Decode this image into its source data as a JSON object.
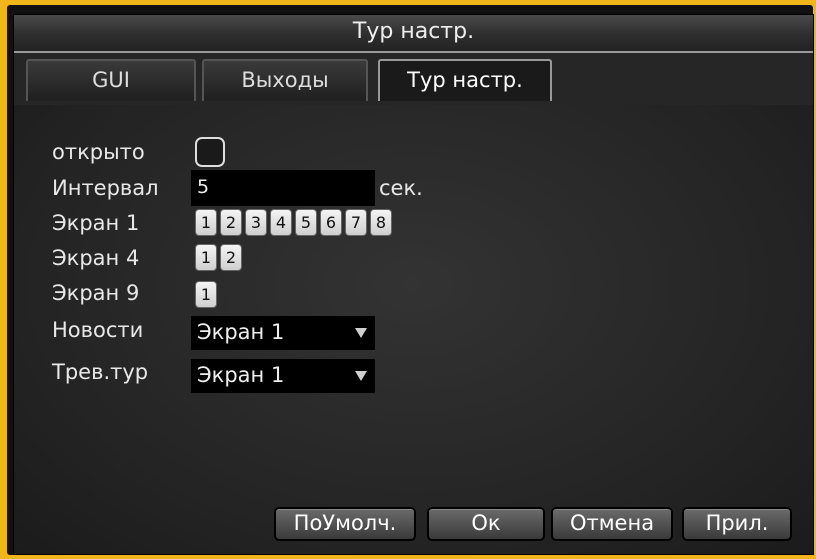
{
  "window": {
    "title": "Тур настр."
  },
  "tabs": [
    {
      "label": "GUI"
    },
    {
      "label": "Выходы"
    },
    {
      "label": "Тур настр.",
      "active": true
    }
  ],
  "form": {
    "open": {
      "label": "открыто",
      "checked": false
    },
    "interval": {
      "label": "Интервал",
      "value": "5",
      "unit": "сек."
    },
    "screen1": {
      "label": "Экран 1",
      "buttons": [
        "1",
        "2",
        "3",
        "4",
        "5",
        "6",
        "7",
        "8"
      ]
    },
    "screen4": {
      "label": "Экран 4",
      "buttons": [
        "1",
        "2"
      ]
    },
    "screen9": {
      "label": "Экран 9",
      "buttons": [
        "1"
      ]
    },
    "news": {
      "label": "Новости",
      "value": "Экран 1"
    },
    "alarm_tour": {
      "label": "Трев.тур",
      "value": "Экран 1"
    }
  },
  "buttons": {
    "default": "ПоУмолч.",
    "ok": "Ок",
    "cancel": "Отмена",
    "apply": "Прил."
  },
  "colors": {
    "frame": "#f1b51c",
    "background": "#262626"
  }
}
